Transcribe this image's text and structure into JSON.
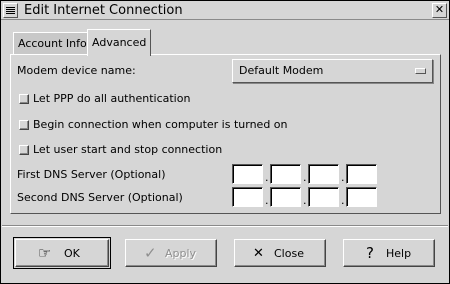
{
  "window": {
    "title": "Edit Internet Connection"
  },
  "tabs": [
    {
      "label": "Account Info",
      "active": false
    },
    {
      "label": "Advanced",
      "active": true
    }
  ],
  "form": {
    "modem_label": "Modem device name:",
    "modem_value": "Default Modem",
    "checkboxes": [
      {
        "label": "Let PPP do all authentication",
        "checked": false
      },
      {
        "label": "Begin connection when computer is turned on",
        "checked": false
      },
      {
        "label": "Let user start and stop connection",
        "checked": false
      }
    ],
    "dns1_label": "First DNS Server (Optional)",
    "dns2_label": "Second DNS Server (Optional)",
    "dns1": [
      "",
      "",
      "",
      ""
    ],
    "dns2": [
      "",
      "",
      "",
      ""
    ],
    "ip_separator": "."
  },
  "buttons": {
    "ok": {
      "label": "OK",
      "icon": "ok-hand-icon"
    },
    "apply": {
      "label": "Apply",
      "icon": "checkmark-icon",
      "disabled": true
    },
    "close": {
      "label": "Close",
      "icon": "x-icon"
    },
    "help": {
      "label": "Help",
      "icon": "question-icon"
    }
  }
}
